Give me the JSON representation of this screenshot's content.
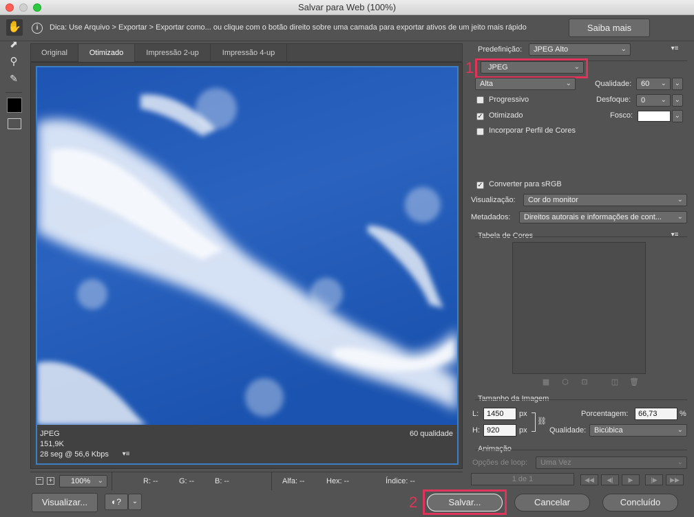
{
  "window": {
    "title": "Salvar para Web (100%)"
  },
  "hint": {
    "text": "Dica: Use Arquivo > Exportar > Exportar como...  ou clique com o botão direito sobre uma camada para exportar ativos de um jeito mais rápido",
    "learn_more": "Saiba mais"
  },
  "tabs": [
    "Original",
    "Otimizado",
    "Impressão 2-up",
    "Impressão 4-up"
  ],
  "preview": {
    "format": "JPEG",
    "size": "151,9K",
    "time": "28 seg @ 56,6 Kbps",
    "quality_label": "60 qualidade"
  },
  "settings": {
    "preset_label": "Predefinição:",
    "preset_value": "JPEG Alto",
    "format_value": "JPEG",
    "quality_level": "Alta",
    "quality_label": "Qualidade:",
    "quality_value": "60",
    "progressive": "Progressivo",
    "blur_label": "Desfoque:",
    "blur_value": "0",
    "optimized": "Otimizado",
    "matte_label": "Fosco:",
    "embed_profile": "Incorporar Perfil de Cores",
    "convert_srgb": "Converter para sRGB",
    "preview_label": "Visualização:",
    "preview_value": "Cor do monitor",
    "metadata_label": "Metadados:",
    "metadata_value": "Direitos autorais e informações de cont...",
    "color_table": "Tabela de Cores",
    "image_size": "Tamanho da Imagem",
    "w_label": "L:",
    "w_value": "1450",
    "h_label": "H:",
    "h_value": "920",
    "px": "px",
    "percent_label": "Porcentagem:",
    "percent_value": "66,73",
    "percent_sign": "%",
    "resample_label": "Qualidade:",
    "resample_value": "Bicúbica",
    "animation": "Animação",
    "loop_label": "Opções de loop:",
    "loop_value": "Uma Vez",
    "frame": "1 de 1"
  },
  "statusbar": {
    "zoom": "100%",
    "r": "R: --",
    "g": "G: --",
    "b": "B: --",
    "alpha": "Alfa: --",
    "hex": "Hex: --",
    "index": "Índice: --"
  },
  "footer": {
    "preview_btn": "Visualizar...",
    "save_btn": "Salvar...",
    "cancel_btn": "Cancelar",
    "done_btn": "Concluído"
  },
  "annotations": {
    "one": "1",
    "two": "2"
  },
  "colors": {
    "highlight": "#e0345a",
    "accent": "#3d7fc4"
  }
}
